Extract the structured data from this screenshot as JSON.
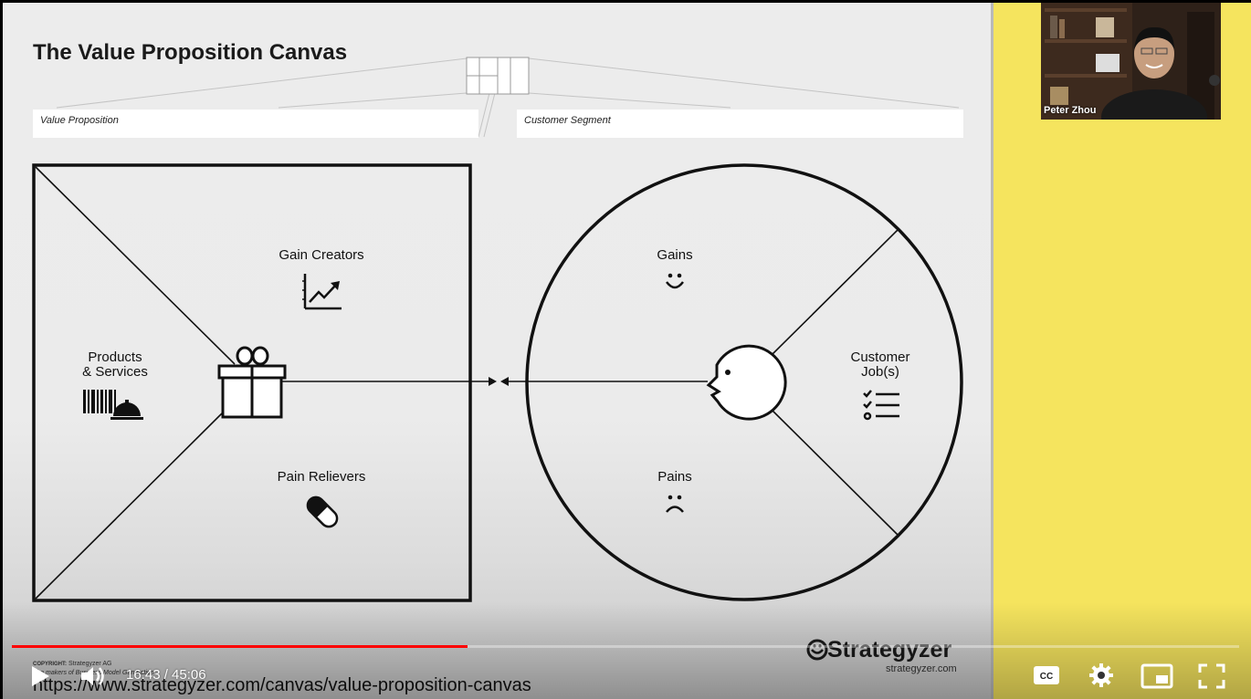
{
  "slide": {
    "title": "The Value Proposition Canvas",
    "value_proposition_label": "Value Proposition",
    "customer_segment_label": "Customer Segment",
    "gain_creators": "Gain Creators",
    "products_services_line1": "Products",
    "products_services_line2": "& Services",
    "pain_relievers": "Pain Relievers",
    "gains": "Gains",
    "pains": "Pains",
    "customer_jobs_line1": "Customer",
    "customer_jobs_line2": "Job(s)",
    "copyright_label": "COPYRIGHT:",
    "copyright_owner": "Strategyzer AG",
    "copyright_line2": "The makers of Business Model Generation",
    "brand": "Strategyzer",
    "brand_site": "strategyzer.com",
    "url": "https://www.strategyzer.com/canvas/value-proposition-canvas"
  },
  "webcam": {
    "participant_name": "Peter Zhou"
  },
  "player": {
    "current_time": "16:43",
    "duration": "45:06",
    "time_display": "16:43 / 45:06",
    "progress": 0.371,
    "buttons": {
      "play": "play-icon",
      "volume": "volume-icon",
      "captions": "CC",
      "settings": "gear-icon",
      "miniplayer": "miniplayer-icon",
      "fullscreen": "fullscreen-icon"
    },
    "accent_color": "#ff0000"
  },
  "colors": {
    "sidebar": "#f5e45e",
    "slide_background": "#ececec"
  }
}
